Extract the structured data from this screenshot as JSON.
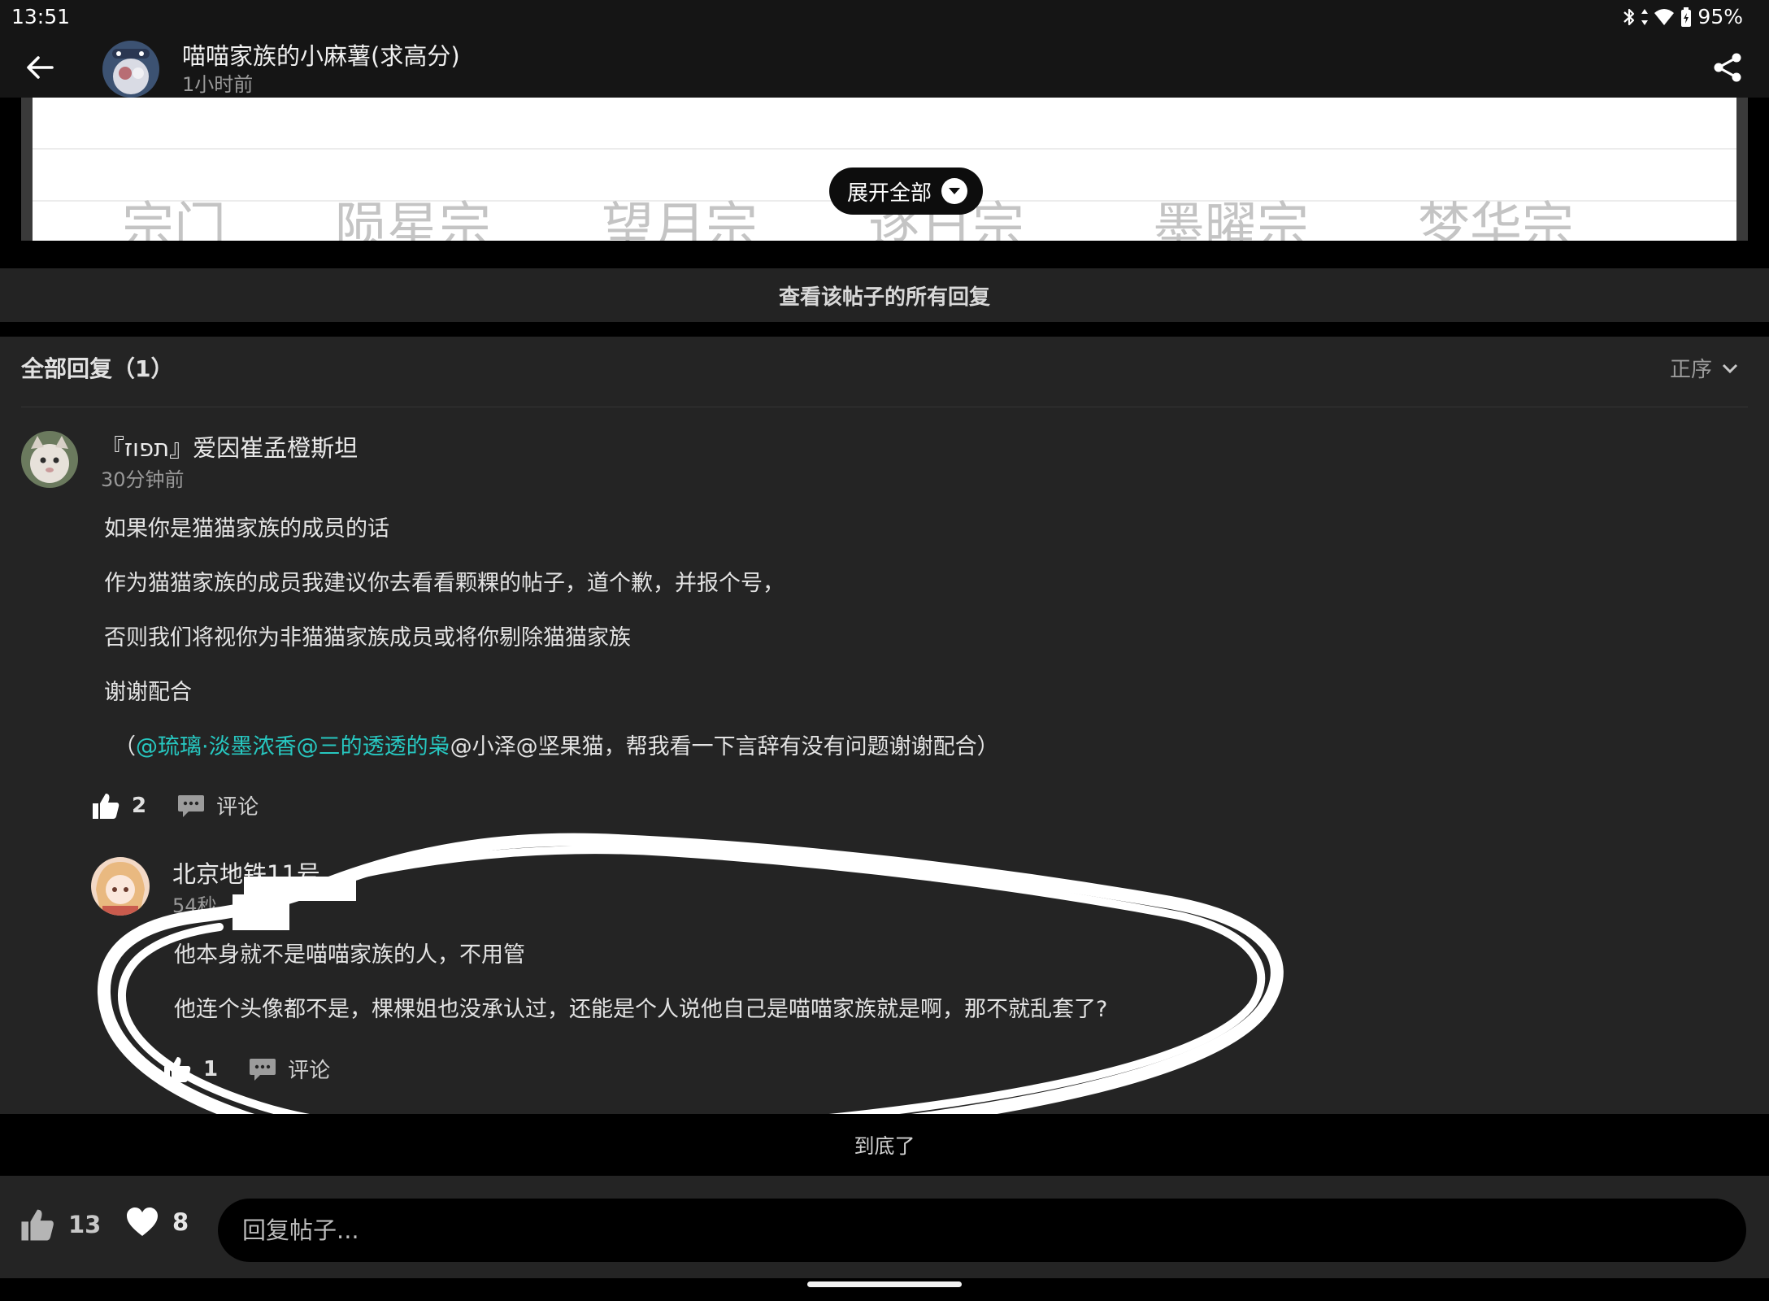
{
  "status_bar": {
    "time": "13:51",
    "battery": "95%"
  },
  "header": {
    "title": "喵喵家族的小麻薯(求高分)",
    "time": "1小时前"
  },
  "post_preview": {
    "sects": [
      "宗门",
      "陨星宗",
      "望月宗",
      "逐日宗",
      "墨曜宗",
      "梦华宗"
    ],
    "expand_label": "展开全部"
  },
  "view_all_label": "查看该帖子的所有回复",
  "replies_header": {
    "title": "全部回复（1）",
    "sort_label": "正序"
  },
  "comment": {
    "author": "『תפוז』爱因崔孟橙斯坦",
    "time": "30分钟前",
    "lines": [
      "如果你是猫猫家族的成员的话",
      "作为猫猫家族的成员我建议你去看看颗粿的帖子，道个歉，并报个号，",
      "否则我们将视你为非猫猫家族成员或将你剔除猫猫家族",
      "谢谢配合"
    ],
    "mention_open": "（",
    "mention_highlight": "@琉璃·淡墨浓香@三的透透的枭",
    "mention_rest": "@小泽@坚果猫，帮我看一下言辞有没有问题谢谢配合）",
    "likes": "2",
    "comment_label": "评论"
  },
  "sub_reply": {
    "author": "北京地铁11号",
    "time": "54秒",
    "lines": [
      "他本身就不是喵喵家族的人，不用管",
      "他连个头像都不是，棵棵姐也没承认过，还能是个人说他自己是喵喵家族就是啊，那不就乱套了?"
    ],
    "likes": "1",
    "comment_label": "评论"
  },
  "end_label": "到底了",
  "bottom_bar": {
    "likes": "13",
    "favorites": "8",
    "reply_placeholder": "回复帖子..."
  },
  "colors": {
    "mention": "#27c7c0",
    "background": "#242424"
  },
  "icons": {
    "back": "arrow-left-icon",
    "share": "share-icon",
    "expand": "chevron-down-circle-icon",
    "sort": "chevron-down-icon",
    "like": "thumbs-up-icon",
    "comment": "speech-bubble-icon",
    "favorite": "heart-icon"
  }
}
